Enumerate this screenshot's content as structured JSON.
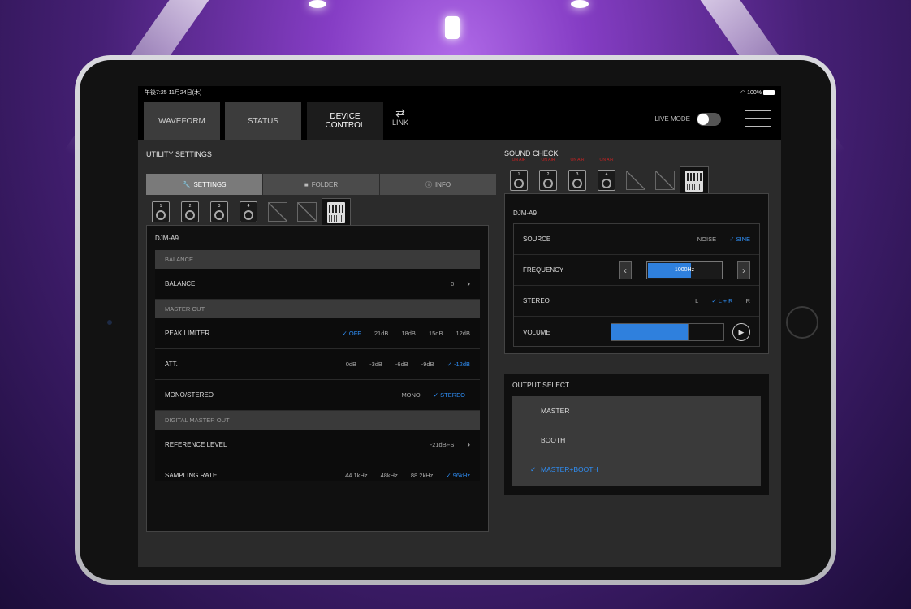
{
  "status_bar": {
    "time": "午後7:25 11月24日(木)",
    "battery": "100%"
  },
  "tabs": [
    {
      "label": "WAVEFORM"
    },
    {
      "label": "STATUS"
    },
    {
      "label": "DEVICE",
      "label2": "CONTROL"
    }
  ],
  "link": {
    "label": "LINK",
    "icon": "swap-arrows-icon"
  },
  "live_mode": {
    "label": "LIVE MODE",
    "on": false
  },
  "utility": {
    "title": "UTILITY SETTINGS",
    "segments": [
      {
        "label": "SETTINGS",
        "icon": "wrench-icon",
        "active": true
      },
      {
        "label": "FOLDER",
        "icon": "folder-icon",
        "active": false
      },
      {
        "label": "INFO",
        "icon": "info-icon",
        "active": false
      }
    ],
    "players": [
      "1",
      "2",
      "3",
      "4"
    ],
    "device_name": "DJM-A9",
    "sections": {
      "balance_head": "BALANCE",
      "balance": {
        "label": "BALANCE",
        "value": "0"
      },
      "master_out_head": "MASTER OUT",
      "peak_limiter": {
        "label": "PEAK LIMITER",
        "options": [
          "OFF",
          "21dB",
          "18dB",
          "15dB",
          "12dB"
        ],
        "selected": "OFF"
      },
      "att": {
        "label": "ATT.",
        "options": [
          "0dB",
          "-3dB",
          "-6dB",
          "-9dB",
          "-12dB"
        ],
        "selected": "-12dB"
      },
      "mono_stereo": {
        "label": "MONO/STEREO",
        "options": [
          "MONO",
          "STEREO"
        ],
        "selected": "STEREO"
      },
      "digital_master_head": "DIGITAL MASTER OUT",
      "reference_level": {
        "label": "REFERENCE LEVEL",
        "value": "-21dBFS"
      },
      "sampling_rate": {
        "label": "SAMPLING RATE",
        "options": [
          "44.1kHz",
          "48kHz",
          "88.2kHz",
          "96kHz"
        ],
        "selected": "96kHz"
      }
    }
  },
  "sound_check": {
    "title": "SOUND CHECK",
    "on_air": "ON AIR",
    "players": [
      "1",
      "2",
      "3",
      "4"
    ],
    "device_name": "DJM-A9",
    "source": {
      "label": "SOURCE",
      "options": [
        "NOISE",
        "SINE"
      ],
      "selected": "SINE"
    },
    "frequency": {
      "label": "FREQUENCY",
      "value": "1000Hz",
      "level": 0.58
    },
    "stereo": {
      "label": "STEREO",
      "options": [
        "L",
        "L + R",
        "R"
      ],
      "selected": "L + R"
    },
    "volume": {
      "label": "VOLUME",
      "level": 0.67
    }
  },
  "output_select": {
    "title": "OUTPUT SELECT",
    "items": [
      {
        "label": "MASTER",
        "selected": false
      },
      {
        "label": "BOOTH",
        "selected": false
      },
      {
        "label": "MASTER+BOOTH",
        "selected": true
      }
    ]
  },
  "colors": {
    "accent": "#2f8ff7",
    "on_air": "#cc2222"
  }
}
